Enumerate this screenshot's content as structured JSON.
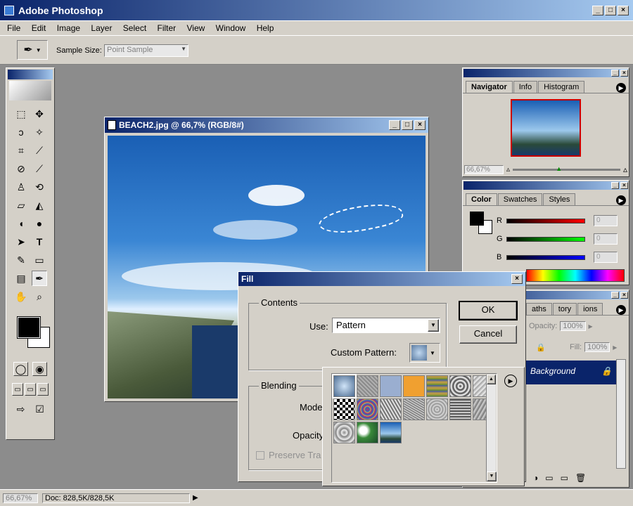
{
  "app": {
    "title": "Adobe Photoshop"
  },
  "menu": [
    "File",
    "Edit",
    "Image",
    "Layer",
    "Select",
    "Filter",
    "View",
    "Window",
    "Help"
  ],
  "options": {
    "sample_size_label": "Sample Size:",
    "sample_size_value": "Point Sample"
  },
  "document": {
    "title": "BEACH2.jpg @ 66,7% (RGB/8#)"
  },
  "navigator": {
    "tabs": [
      "Navigator",
      "Info",
      "Histogram"
    ],
    "zoom": "66,67%"
  },
  "color": {
    "tabs": [
      "Color",
      "Swatches",
      "Styles"
    ],
    "channels": [
      {
        "label": "R",
        "value": "0"
      },
      {
        "label": "G",
        "value": "0"
      },
      {
        "label": "B",
        "value": "0"
      }
    ]
  },
  "layers": {
    "tabs": [
      "aths",
      "tory",
      "ions"
    ],
    "opacity_label": "Opacity:",
    "opacity_value": "100%",
    "fill_label": "Fill:",
    "fill_value": "100%",
    "layer_name": "Background"
  },
  "fill_dialog": {
    "title": "Fill",
    "contents_label": "Contents",
    "use_label": "Use:",
    "use_value": "Pattern",
    "custom_pattern_label": "Custom Pattern:",
    "blending_label": "Blending",
    "mode_label": "Mode",
    "opacity_label": "Opacity",
    "preserve_label": "Preserve Tra",
    "ok": "OK",
    "cancel": "Cancel"
  },
  "status": {
    "zoom": "66,67%",
    "doc": "Doc: 828,5K/828,5K"
  },
  "window_controls": {
    "minimize": "_",
    "maximize": "□",
    "close": "×"
  }
}
